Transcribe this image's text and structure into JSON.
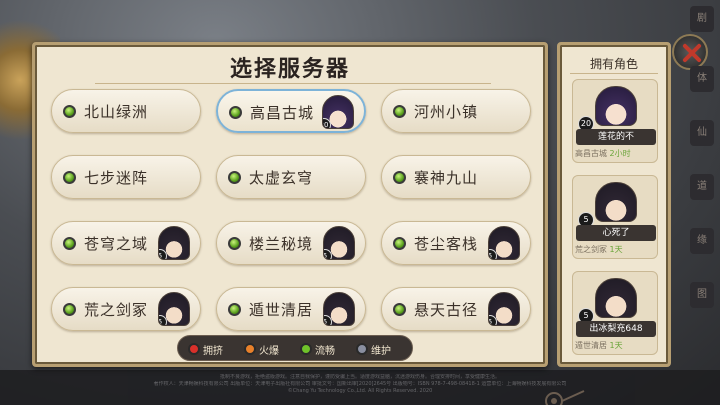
{
  "main": {
    "title": "选择服务器",
    "servers": [
      {
        "name": "北山绿洲",
        "status": "流畅",
        "selected": false
      },
      {
        "name": "高昌古城",
        "status": "流畅",
        "selected": true,
        "role_level": "20"
      },
      {
        "name": "河州小镇",
        "status": "流畅",
        "selected": false
      },
      {
        "name": "七步迷阵",
        "status": "流畅",
        "selected": false
      },
      {
        "name": "太虚玄穹",
        "status": "流畅",
        "selected": false
      },
      {
        "name": "褰神九山",
        "status": "流畅",
        "selected": false
      },
      {
        "name": "苍穹之域",
        "status": "流畅",
        "selected": false,
        "role_level": "5"
      },
      {
        "name": "楼兰秘境",
        "status": "流畅",
        "selected": false,
        "role_level": "5"
      },
      {
        "name": "苍尘客栈",
        "status": "流畅",
        "selected": false,
        "role_level": "5"
      },
      {
        "name": "荒之剑冢",
        "status": "流畅",
        "selected": false,
        "role_level": "5"
      },
      {
        "name": "遁世清居",
        "status": "流畅",
        "selected": false,
        "role_level": "5"
      },
      {
        "name": "悬天古径",
        "status": "流畅",
        "selected": false,
        "role_level": "5"
      }
    ],
    "legend": [
      {
        "label": "拥挤",
        "color": "#d9302a"
      },
      {
        "label": "火爆",
        "color": "#e8802a"
      },
      {
        "label": "流畅",
        "color": "#6fc22a"
      },
      {
        "label": "维护",
        "color": "#8a8fa0"
      }
    ]
  },
  "side": {
    "title": "拥有角色",
    "roles": [
      {
        "level": "20",
        "name": "莲花的不",
        "server": "高昌古城",
        "time": "2小时"
      },
      {
        "level": "5",
        "name": "心死了",
        "server": "荒之剑冢",
        "time": "1天"
      },
      {
        "level": "5",
        "name": "出冰梨充648",
        "server": "遁世清居",
        "time": "1天"
      }
    ]
  },
  "right_tabs": [
    "剧",
    "体",
    "仙",
    "道",
    "缘",
    "图"
  ],
  "footer": [
    "抵制不良游戏，拒绝盗版游戏。注意自我保护，谨防受骗上当。适度游戏益脑，沉迷游戏伤身。合理安排时间，享受健康生活。",
    "著作权人：天津畅娱科技有限公司  出版单位：天津电子出版社有限公司  审批文号：国新出审[2020]2645号  出版物号：ISBN 978-7-498-08418-1  运营单位：上海畅娱科技发展有限公司",
    "©Chang Yu Technology Co.,Ltd. All Rights Reserved. 2020"
  ],
  "colors": {
    "panel": "#efe6d1",
    "border": "#b79f72",
    "status_ok": "#6fc22a",
    "selected": "#7db3d8"
  }
}
